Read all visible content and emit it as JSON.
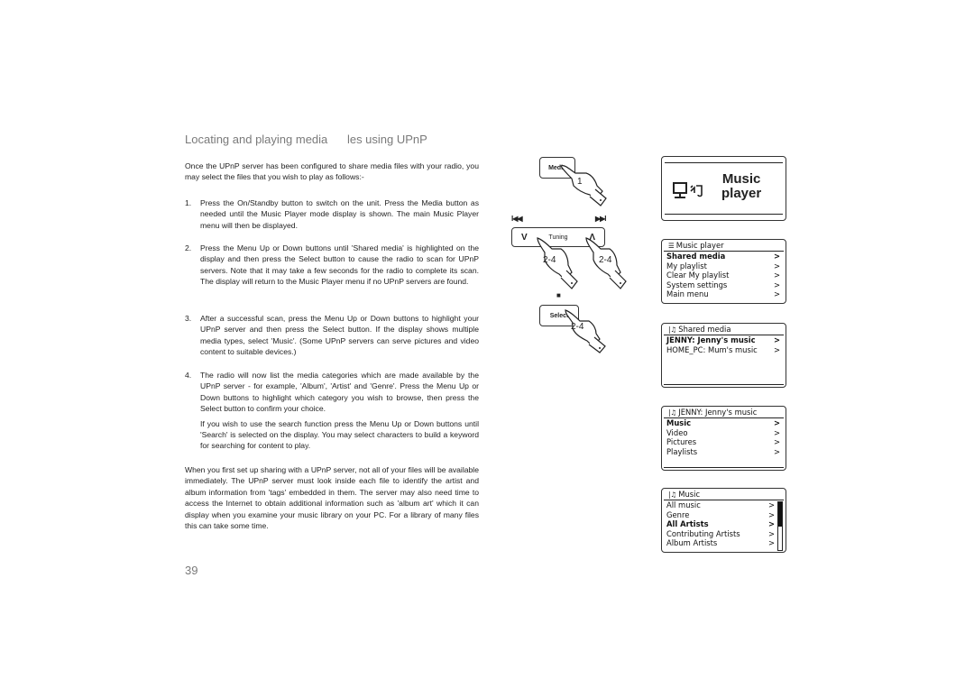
{
  "page": {
    "title": "Locating and playing media      les using UPnP",
    "intro": "Once the UPnP server has been configured to share media files with your radio, you may select the files that you wish to play as follows:-",
    "steps": [
      {
        "num": "1.",
        "paragraphs": [
          "Press the On/Standby  button to switch on the unit. Press the Media button as needed until the Music Player mode display is shown. The main Music Player menu will then be displayed."
        ]
      },
      {
        "num": "2.",
        "paragraphs": [
          "Press the Menu Up or Down buttons until 'Shared media' is highlighted on the display and then press the Select  button to cause the radio to scan for UPnP servers. Note that it may take a few seconds for the radio to complete its scan. The display will return to the Music Player menu if no UPnP servers are found."
        ]
      },
      {
        "num": "3.",
        "paragraphs": [
          "After a successful scan, press the Menu Up  or Down  buttons to highlight your UPnP server and then press the Select  button. If the display shows multiple media types, select 'Music'. (Some UPnP servers can serve pictures and video content to suitable devices.)"
        ]
      },
      {
        "num": "4.",
        "paragraphs": [
          "The radio will now list the media categories which are made available by the UPnP server - for example, 'Album', 'Artist' and 'Genre'. Press the Menu Up  or Down  buttons to highlight which category you wish to browse, then press the Select  button to confirm your choice.",
          "If you wish to use the search function press the Menu Up  or Down buttons until 'Search' is selected on the display. You may select characters to build a keyword for searching for content to play."
        ]
      }
    ],
    "footer_paragraph": "When you first set up sharing with a UPnP server, not all of your files will be available immediately. The UPnP server must look inside each file to identify the artist and album information from 'tags' embedded in them. The server  may also need time to access the Internet to obtain additional information such as 'album art' which it can display when you examine your music library on your PC. For a library of many files this can take some time.",
    "page_number": "39"
  },
  "illustration": {
    "media_button": {
      "label": "Media",
      "step": "1"
    },
    "tuning_button": {
      "label": "Tuning",
      "down_glyph": "V",
      "up_glyph": "Λ",
      "prev_glyph": "I◀◀",
      "next_glyph": "▶▶I",
      "step_left": "2-4",
      "step_right": "2-4"
    },
    "select_button": {
      "label": "Select",
      "step": "2-4",
      "stop_glyph": "■"
    }
  },
  "screens": {
    "splash": {
      "line1": "Music",
      "line2": "player",
      "icon": "pc-music-icon"
    },
    "music_player": {
      "icon": "menu-icon",
      "header": "Music player",
      "rows": [
        {
          "label": "Shared media",
          "arrow": ">",
          "selected": true
        },
        {
          "label": "My playlist",
          "arrow": ">",
          "selected": false
        },
        {
          "label": "Clear My playlist",
          "arrow": ">",
          "selected": false
        },
        {
          "label": "System settings",
          "arrow": ">",
          "selected": false
        },
        {
          "label": "Main menu",
          "arrow": ">",
          "selected": false
        }
      ]
    },
    "shared_media": {
      "icon": "music-server-icon",
      "header": "Shared media",
      "rows": [
        {
          "label": "JENNY: Jenny's music",
          "arrow": ">",
          "selected": true
        },
        {
          "label": "HOME_PC: Mum's music",
          "arrow": ">",
          "selected": false
        }
      ]
    },
    "jenny": {
      "icon": "music-server-icon",
      "header": "JENNY: Jenny's music",
      "rows": [
        {
          "label": "Music",
          "arrow": ">",
          "selected": true
        },
        {
          "label": "Video",
          "arrow": ">",
          "selected": false
        },
        {
          "label": "Pictures",
          "arrow": ">",
          "selected": false
        },
        {
          "label": "Playlists",
          "arrow": ">",
          "selected": false
        }
      ]
    },
    "music": {
      "icon": "music-server-icon",
      "header": "Music",
      "scroll_fraction_visible": 0.5,
      "rows": [
        {
          "label": "All music",
          "arrow": ">",
          "selected": false
        },
        {
          "label": "Genre",
          "arrow": ">",
          "selected": false
        },
        {
          "label": "All Artists",
          "arrow": ">",
          "selected": true
        },
        {
          "label": "Contributing Artists",
          "arrow": ">",
          "selected": false
        },
        {
          "label": "Album Artists",
          "arrow": ">",
          "selected": false
        }
      ]
    }
  }
}
